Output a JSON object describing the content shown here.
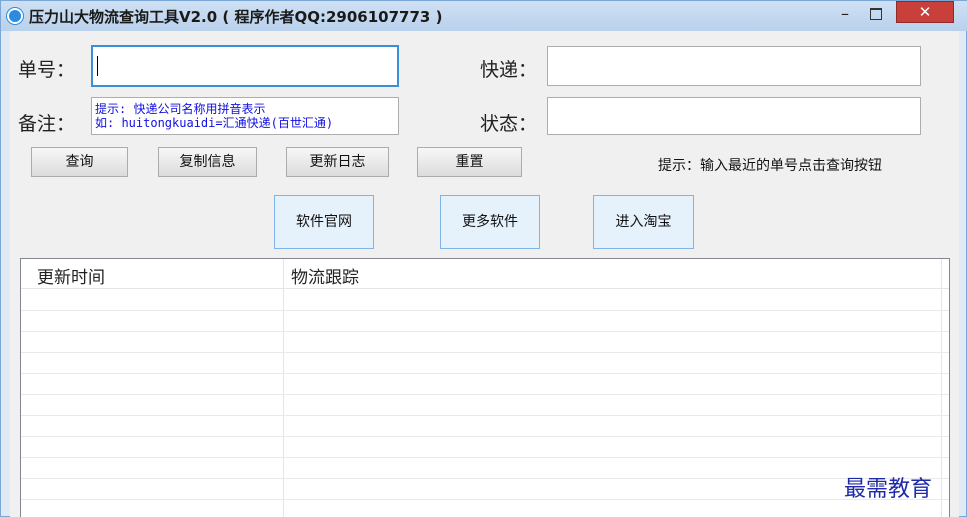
{
  "window": {
    "title": "压力山大物流查询工具V2.0 ( 程序作者QQ:2906107773 )",
    "icon": "app-logo-icon",
    "minimize_label": "–",
    "close_label": "✕"
  },
  "form": {
    "tracking_label": "单号：",
    "tracking_value": "",
    "courier_label": "快递：",
    "courier_value": "",
    "note_label": "备注：",
    "note_line1": "提示: 快递公司名称用拼音表示",
    "note_line2": "如: huitongkuaidi=汇通快递(百世汇通)",
    "status_label": "状态：",
    "status_value": ""
  },
  "buttons": {
    "query": "查询",
    "copy_info": "复制信息",
    "changelog": "更新日志",
    "reset": "重置",
    "official_site": "软件官网",
    "more_software": "更多软件",
    "taobao": "进入淘宝"
  },
  "hint": "提示：输入最近的单号点击查询按钮",
  "table": {
    "columns": [
      "更新时间",
      "物流跟踪"
    ],
    "rows": []
  },
  "watermark": "最需教育",
  "colors": {
    "accent": "#3c8ed9",
    "note_text": "#1010e0",
    "close_button": "#c9403a"
  }
}
